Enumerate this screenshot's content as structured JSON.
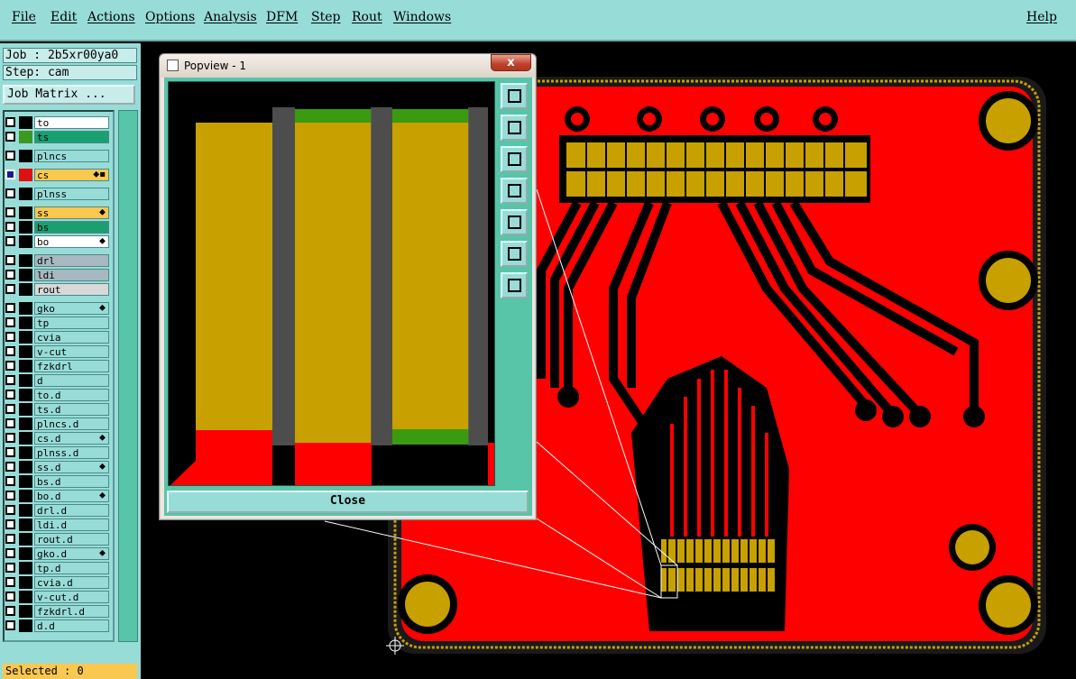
{
  "menu": {
    "file": "File",
    "edit": "Edit",
    "actions": "Actions",
    "options": "Options",
    "analysis": "Analysis",
    "dfm": "DFM",
    "step": "Step",
    "rout": "Rout",
    "windows": "Windows",
    "help": "Help"
  },
  "job": {
    "job_label": "Job : 2b5xr00ya0",
    "step_label": "Step: cam",
    "matrix_button": "Job Matrix ..."
  },
  "layers": [
    {
      "name": "to",
      "color": "#ffffff",
      "swatch": "#000000"
    },
    {
      "name": "ts",
      "color": "#1aa070",
      "swatch": "#3a9a20"
    },
    {
      "name": "plncs",
      "color": "#98dcd8",
      "swatch": "#000000"
    },
    {
      "name": "cs",
      "color": "#f8c850",
      "swatch": "#e01010",
      "mark": "⬥▪",
      "active": true
    },
    {
      "name": "plnss",
      "color": "#98dcd8",
      "swatch": "#000000"
    },
    {
      "name": "ss",
      "color": "#f8c850",
      "swatch": "#000000",
      "mark": "⬥"
    },
    {
      "name": "bs",
      "color": "#1aa070",
      "swatch": "#000000"
    },
    {
      "name": "bo",
      "color": "#ffffff",
      "swatch": "#000000",
      "mark": "⬥"
    },
    {
      "name": "drl",
      "color": "#a8b8c0",
      "swatch": "#000000"
    },
    {
      "name": "ldi",
      "color": "#a8b8c0",
      "swatch": "#000000"
    },
    {
      "name": "rout",
      "color": "#d8d8d8",
      "swatch": "#000000"
    },
    {
      "name": "gko",
      "color": "#98dcd8",
      "swatch": "#000000",
      "mark": "⬥"
    },
    {
      "name": "tp",
      "color": "#98dcd8",
      "swatch": "#000000"
    },
    {
      "name": "cvia",
      "color": "#98dcd8",
      "swatch": "#000000"
    },
    {
      "name": "v-cut",
      "color": "#98dcd8",
      "swatch": "#000000"
    },
    {
      "name": "fzkdrl",
      "color": "#98dcd8",
      "swatch": "#000000"
    },
    {
      "name": "d",
      "color": "#98dcd8",
      "swatch": "#000000"
    },
    {
      "name": "to.d",
      "color": "#98dcd8",
      "swatch": "#000000"
    },
    {
      "name": "ts.d",
      "color": "#98dcd8",
      "swatch": "#000000"
    },
    {
      "name": "plncs.d",
      "color": "#98dcd8",
      "swatch": "#000000"
    },
    {
      "name": "cs.d",
      "color": "#98dcd8",
      "swatch": "#000000",
      "mark": "⬥"
    },
    {
      "name": "plnss.d",
      "color": "#98dcd8",
      "swatch": "#000000"
    },
    {
      "name": "ss.d",
      "color": "#98dcd8",
      "swatch": "#000000",
      "mark": "⬥"
    },
    {
      "name": "bs.d",
      "color": "#98dcd8",
      "swatch": "#000000"
    },
    {
      "name": "bo.d",
      "color": "#98dcd8",
      "swatch": "#000000",
      "mark": "⬥"
    },
    {
      "name": "drl.d",
      "color": "#98dcd8",
      "swatch": "#000000"
    },
    {
      "name": "ldi.d",
      "color": "#98dcd8",
      "swatch": "#000000"
    },
    {
      "name": "rout.d",
      "color": "#98dcd8",
      "swatch": "#000000"
    },
    {
      "name": "gko.d",
      "color": "#98dcd8",
      "swatch": "#000000",
      "mark": "⬥"
    },
    {
      "name": "tp.d",
      "color": "#98dcd8",
      "swatch": "#000000"
    },
    {
      "name": "cvia.d",
      "color": "#98dcd8",
      "swatch": "#000000"
    },
    {
      "name": "v-cut.d",
      "color": "#98dcd8",
      "swatch": "#000000"
    },
    {
      "name": "fzkdrl.d",
      "color": "#98dcd8",
      "swatch": "#000000"
    },
    {
      "name": "d.d",
      "color": "#98dcd8",
      "swatch": "#000000"
    }
  ],
  "status": {
    "selected": "Selected : 0"
  },
  "popview": {
    "title": "Popview - 1",
    "close_x": "x",
    "close_button": "Close"
  },
  "colors": {
    "copper": "#ff0000",
    "pad": "#c8a000",
    "mask": "#3a9a10",
    "background": "#000000",
    "panel": "#98dcd8"
  }
}
